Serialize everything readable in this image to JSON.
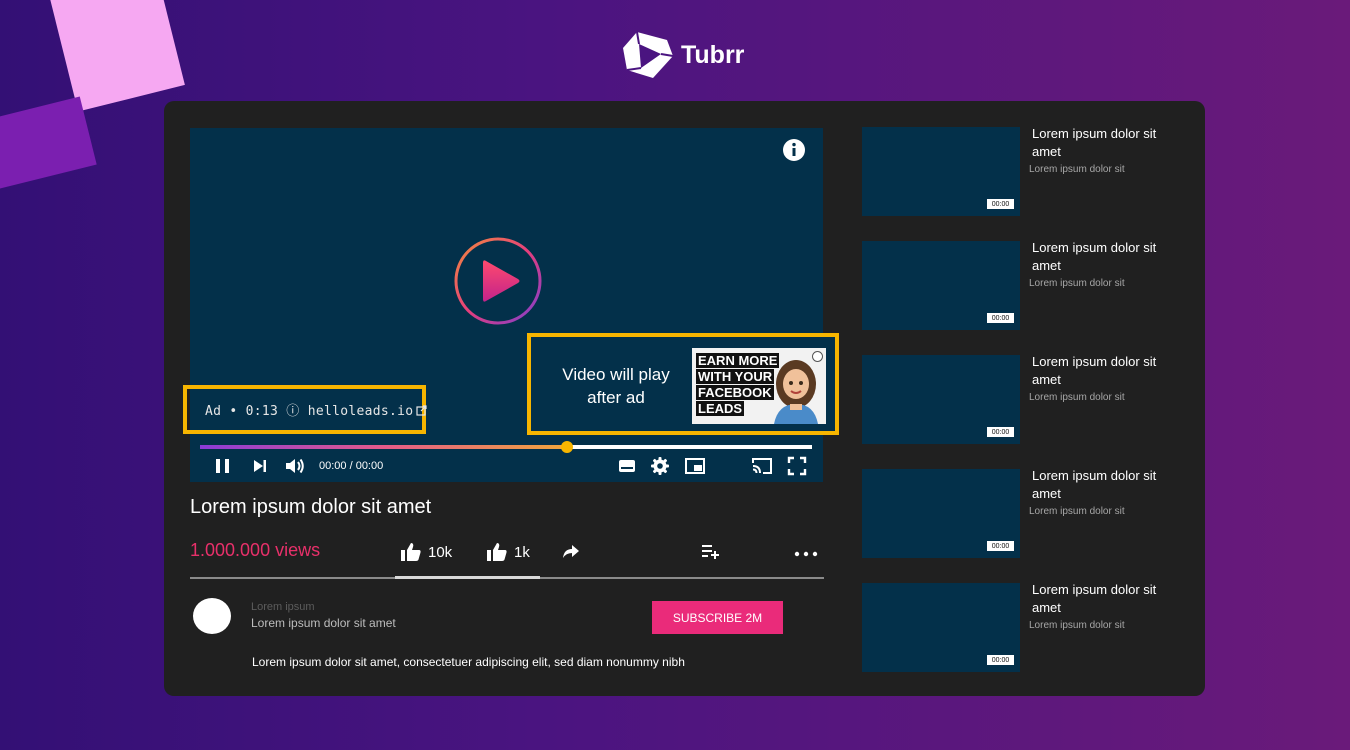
{
  "brand": {
    "name": "Tubrr"
  },
  "colors": {
    "accent": "#f7b500",
    "pink": "#e8306a",
    "player_bg": "#03304a",
    "panel_bg": "#202020"
  },
  "player": {
    "ad_label": "Ad • 0:13 ⓘ helloleads.io",
    "ad_card_text": "Video will play after ad",
    "ad_thumb_lines": [
      "EARN MORE",
      "WITH YOUR",
      "FACEBOOK",
      "LEADS"
    ],
    "progress_fraction": 0.6,
    "time": "00:00 / 00:00",
    "icons": [
      "info-icon",
      "play-icon",
      "pause-icon",
      "next-icon",
      "volume-icon",
      "subtitles-icon",
      "settings-icon",
      "miniplayer-icon",
      "cast-icon",
      "fullscreen-icon"
    ]
  },
  "video": {
    "title": "Lorem ipsum dolor sit amet",
    "views": "1.000.000 views",
    "likes": "10k",
    "dislikes": "1k"
  },
  "channel": {
    "name": "Lorem ipsum",
    "subtitle": "Lorem ipsum dolor sit amet",
    "subscribe": "SUBSCRIBE  2M"
  },
  "description": "Lorem ipsum dolor sit amet, consectetuer adipiscing elit, sed diam nonummy nibh",
  "recommendations": [
    {
      "title": "Lorem ipsum dolor sit amet",
      "subtitle": "Lorem ipsum dolor sit",
      "duration": "00:00"
    },
    {
      "title": "Lorem ipsum dolor sit amet",
      "subtitle": "Lorem ipsum dolor sit",
      "duration": "00:00"
    },
    {
      "title": "Lorem ipsum dolor sit amet",
      "subtitle": "Lorem ipsum dolor sit",
      "duration": "00:00"
    },
    {
      "title": "Lorem ipsum dolor sit amet",
      "subtitle": "Lorem ipsum dolor sit",
      "duration": "00:00"
    },
    {
      "title": "Lorem ipsum dolor sit amet",
      "subtitle": "Lorem ipsum dolor sit",
      "duration": "00:00"
    }
  ]
}
